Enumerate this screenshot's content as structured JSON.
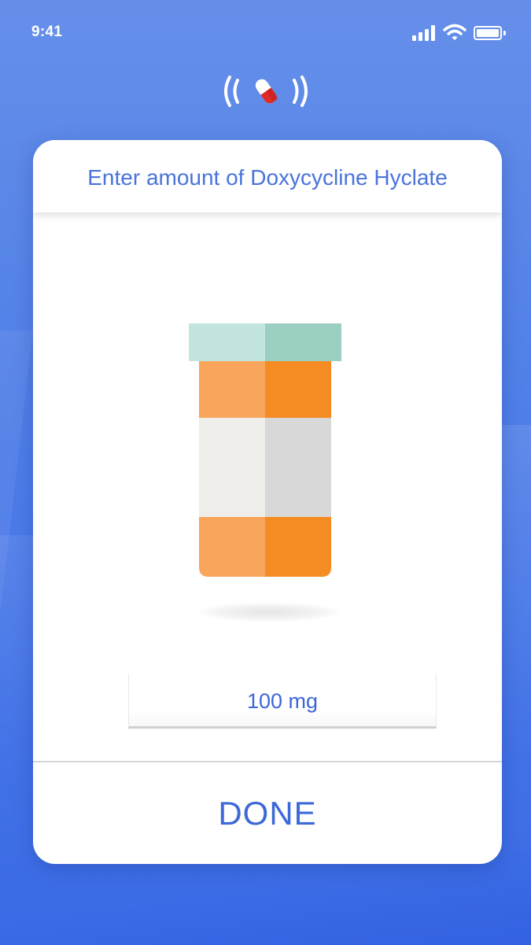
{
  "status_bar": {
    "time": "9:41",
    "icons": [
      "signal-icon",
      "wifi-icon",
      "battery-icon"
    ]
  },
  "app_logo": {
    "icon": "pill-broadcast-icon"
  },
  "card": {
    "prompt": "Enter amount of Doxycycline Hyclate",
    "illustration": "pill-bottle-icon",
    "amount": {
      "value": "100 mg"
    },
    "done_label": "DONE"
  },
  "colors": {
    "background_top": "#658fe9",
    "background_bottom": "#3a6ae6",
    "accent_text": "#4a74dc",
    "bottle_cap_light": "#c3e5df",
    "bottle_cap_dark": "#9bcfc1",
    "bottle_orange_light": "#f9a65c",
    "bottle_orange_dark": "#f58b23",
    "label_light": "#f0eeea",
    "label_dark": "#d8d8d8",
    "pill_red": "#e02a2a"
  }
}
